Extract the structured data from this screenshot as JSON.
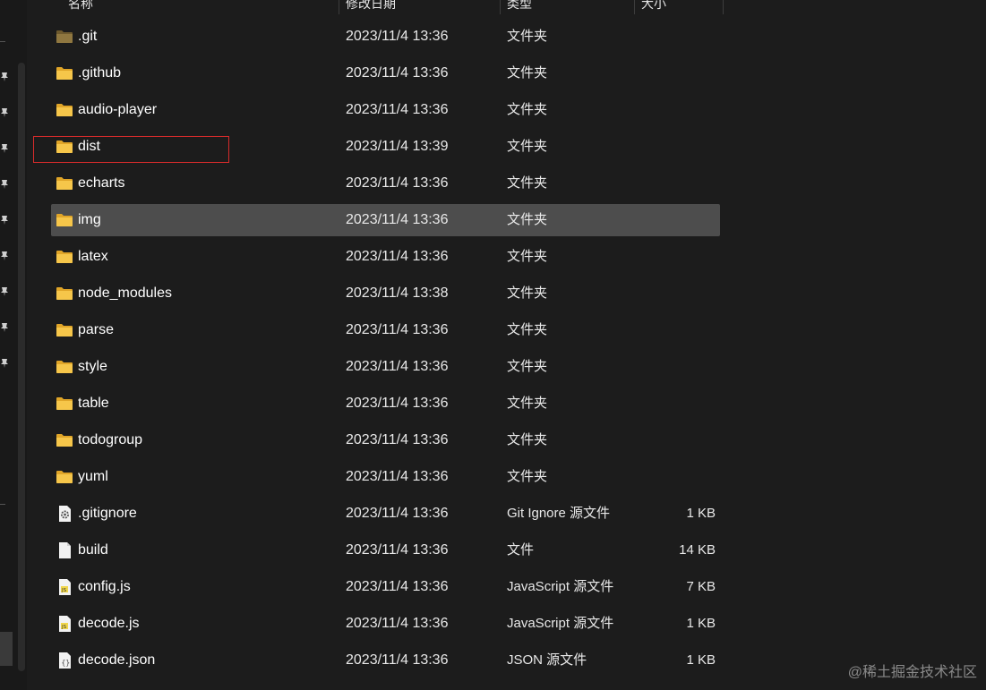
{
  "columns": {
    "name": "名称",
    "date": "修改日期",
    "type": "类型",
    "size": "大小"
  },
  "files": [
    {
      "name": ".git",
      "date": "2023/11/4 13:36",
      "type": "文件夹",
      "size": "",
      "icon": "folder-dim-icon"
    },
    {
      "name": ".github",
      "date": "2023/11/4 13:36",
      "type": "文件夹",
      "size": "",
      "icon": "folder-icon"
    },
    {
      "name": "audio-player",
      "date": "2023/11/4 13:36",
      "type": "文件夹",
      "size": "",
      "icon": "folder-icon"
    },
    {
      "name": "dist",
      "date": "2023/11/4 13:39",
      "type": "文件夹",
      "size": "",
      "icon": "folder-icon",
      "highlighted": true
    },
    {
      "name": "echarts",
      "date": "2023/11/4 13:36",
      "type": "文件夹",
      "size": "",
      "icon": "folder-icon"
    },
    {
      "name": "img",
      "date": "2023/11/4 13:36",
      "type": "文件夹",
      "size": "",
      "icon": "folder-icon",
      "selected": true
    },
    {
      "name": "latex",
      "date": "2023/11/4 13:36",
      "type": "文件夹",
      "size": "",
      "icon": "folder-icon"
    },
    {
      "name": "node_modules",
      "date": "2023/11/4 13:38",
      "type": "文件夹",
      "size": "",
      "icon": "folder-icon"
    },
    {
      "name": "parse",
      "date": "2023/11/4 13:36",
      "type": "文件夹",
      "size": "",
      "icon": "folder-icon"
    },
    {
      "name": "style",
      "date": "2023/11/4 13:36",
      "type": "文件夹",
      "size": "",
      "icon": "folder-icon"
    },
    {
      "name": "table",
      "date": "2023/11/4 13:36",
      "type": "文件夹",
      "size": "",
      "icon": "folder-icon"
    },
    {
      "name": "todogroup",
      "date": "2023/11/4 13:36",
      "type": "文件夹",
      "size": "",
      "icon": "folder-icon"
    },
    {
      "name": "yuml",
      "date": "2023/11/4 13:36",
      "type": "文件夹",
      "size": "",
      "icon": "folder-icon"
    },
    {
      "name": ".gitignore",
      "date": "2023/11/4 13:36",
      "type": "Git Ignore 源文件",
      "size": "1 KB",
      "icon": "gear-file-icon"
    },
    {
      "name": "build",
      "date": "2023/11/4 13:36",
      "type": "文件",
      "size": "14 KB",
      "icon": "blank-file-icon"
    },
    {
      "name": "config.js",
      "date": "2023/11/4 13:36",
      "type": "JavaScript 源文件",
      "size": "7 KB",
      "icon": "js-file-icon"
    },
    {
      "name": "decode.js",
      "date": "2023/11/4 13:36",
      "type": "JavaScript 源文件",
      "size": "1 KB",
      "icon": "js-file-icon"
    },
    {
      "name": "decode.json",
      "date": "2023/11/4 13:36",
      "type": "JSON 源文件",
      "size": "1 KB",
      "icon": "json-file-icon"
    }
  ],
  "watermark": "@稀土掘金技术社区",
  "colors": {
    "background": "#1c1c1c",
    "selected_row": "#4d4d4d",
    "folder": "#f6c64a",
    "highlight_box": "#d62b2b"
  }
}
